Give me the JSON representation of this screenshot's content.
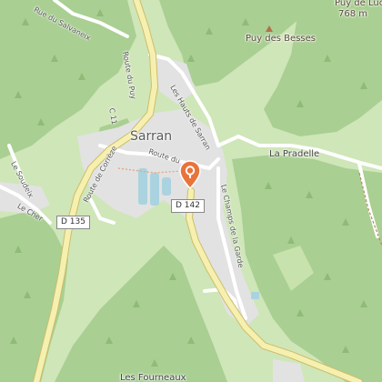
{
  "map": {
    "town": "Sarran",
    "places": [
      "La Pradelle",
      "Les Fourneaux"
    ],
    "peaks": [
      {
        "name": "Puy des Besses"
      },
      {
        "name": "Puy de Luc",
        "elevation": "768 m"
      }
    ],
    "streets": {
      "route_du_puy": "Route du Puy",
      "route_de_correze": "Route de Corrèze",
      "route_du": "Route du",
      "les_hauts": "Les Hauts de Sarran",
      "champs": "Le Champs de la Garde",
      "soudeix": "Le Soudeix",
      "cher": "Le Cher",
      "salvaneix": "Rue du Salvaneix",
      "c11": "C 11"
    },
    "roads": {
      "d135": "D 135",
      "d142": "D 142"
    },
    "marker": {
      "icon": "map-pin-icon",
      "color": "#e8743b"
    },
    "colors": {
      "forest": "#a9cf92",
      "field": "#cfe6b8",
      "urban": "#e2e2e2",
      "major_road": "#f6f0b0",
      "water": "#aad3df"
    }
  }
}
